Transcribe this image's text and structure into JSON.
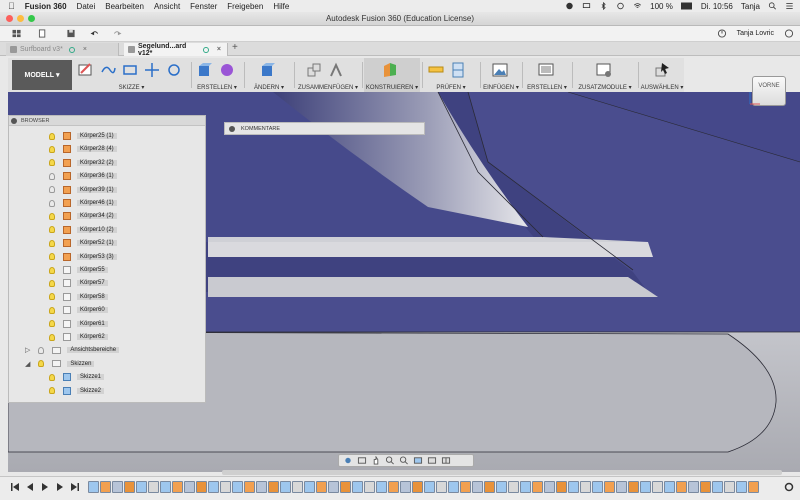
{
  "menubar": {
    "app_name": "Fusion 360",
    "items": [
      "Datei",
      "Bearbeiten",
      "Ansicht",
      "Fenster",
      "Freigeben",
      "Hilfe"
    ],
    "battery": "100 %",
    "clock": "Di. 10:56",
    "user": "Tanja"
  },
  "window": {
    "title": "Autodesk Fusion 360 (Education License)"
  },
  "account": {
    "name": "Tanja Lovric"
  },
  "tabs": [
    {
      "label": "Surfboard v3*",
      "active": false
    },
    {
      "label": "Segelund...ard v12*",
      "active": true
    }
  ],
  "ribbon": {
    "workspace": "MODELL",
    "groups": [
      "SKIZZE",
      "ERSTELLEN",
      "ÄNDERN",
      "ZUSAMMENFÜGEN",
      "KONSTRUIEREN",
      "PRÜFEN",
      "EINFÜGEN",
      "ERSTELLEN",
      "ZUSATZMODULE",
      "AUSWÄHLEN"
    ]
  },
  "viewcube": {
    "label": "VORNE"
  },
  "browser": {
    "title": "BROWSER",
    "bodies": [
      {
        "label": "Körper25 (1)",
        "lit": true,
        "colored": true
      },
      {
        "label": "Körper28 (4)",
        "lit": true,
        "colored": true
      },
      {
        "label": "Körper32 (2)",
        "lit": true,
        "colored": true
      },
      {
        "label": "Körper36 (1)",
        "lit": false,
        "colored": true
      },
      {
        "label": "Körper39 (1)",
        "lit": false,
        "colored": true
      },
      {
        "label": "Körper46 (1)",
        "lit": false,
        "colored": true
      },
      {
        "label": "Körper34 (2)",
        "lit": true,
        "colored": true
      },
      {
        "label": "Körper10 (2)",
        "lit": true,
        "colored": true
      },
      {
        "label": "Körper52 (1)",
        "lit": true,
        "colored": true
      },
      {
        "label": "Körper53 (3)",
        "lit": true,
        "colored": true
      },
      {
        "label": "Körper55",
        "lit": true,
        "colored": false
      },
      {
        "label": "Körper57",
        "lit": true,
        "colored": false
      },
      {
        "label": "Körper58",
        "lit": true,
        "colored": false
      },
      {
        "label": "Körper60",
        "lit": true,
        "colored": false
      },
      {
        "label": "Körper61",
        "lit": true,
        "colored": false
      },
      {
        "label": "Körper62",
        "lit": true,
        "colored": false
      }
    ],
    "folders": [
      {
        "label": "Ansichtsbereiche",
        "lit": false
      },
      {
        "label": "Skizzen",
        "lit": true
      }
    ],
    "sketches": [
      "Skizze1",
      "Skizze2"
    ]
  },
  "comments": {
    "label": "KOMMENTARE"
  },
  "colors": {
    "model_blue": "#4a4d8c",
    "model_blue_dark": "#3c3f7a",
    "model_grey": "#b7b8bf",
    "ribbon_bg": "#e0e0e0",
    "accent_orange": "#f2a050"
  }
}
